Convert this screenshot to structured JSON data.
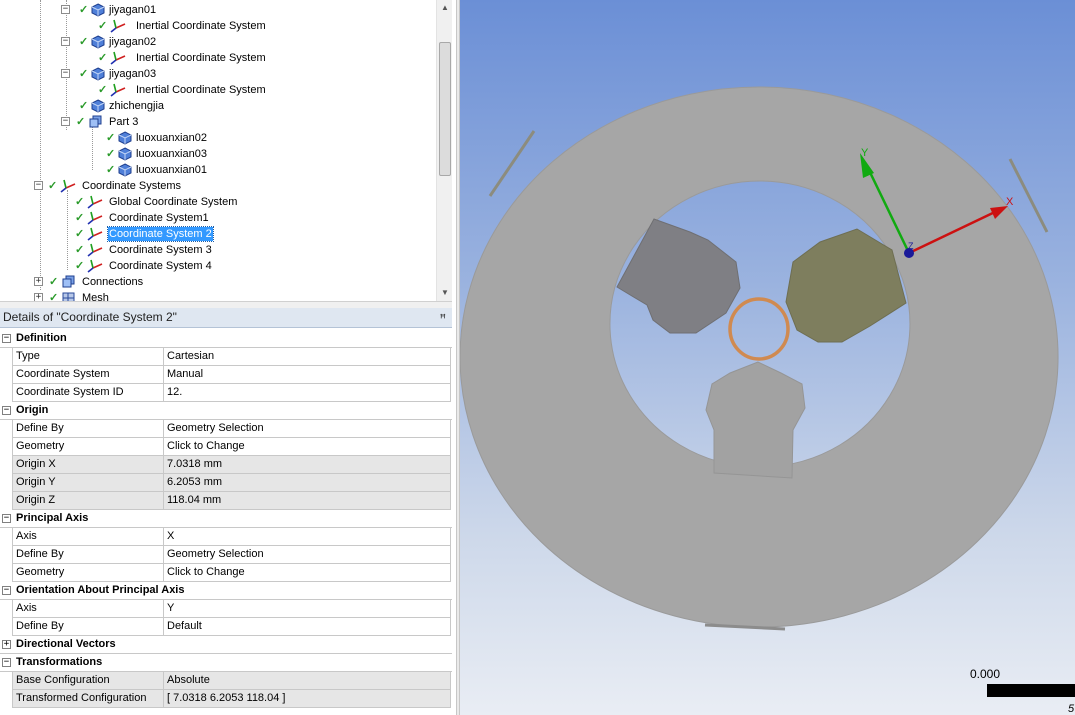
{
  "tree": {
    "items": [
      {
        "label": "jiyagan01",
        "icon": "body-icon",
        "expander": "−"
      },
      {
        "label": "Inertial Coordinate System",
        "icon": "coordinate-system-icon",
        "expander": ""
      },
      {
        "label": "jiyagan02",
        "icon": "body-icon",
        "expander": "−"
      },
      {
        "label": "Inertial Coordinate System",
        "icon": "coordinate-system-icon",
        "expander": ""
      },
      {
        "label": "jiyagan03",
        "icon": "body-icon",
        "expander": "−"
      },
      {
        "label": "Inertial Coordinate System",
        "icon": "coordinate-system-icon",
        "expander": ""
      },
      {
        "label": "zhichengjia",
        "icon": "body-icon",
        "expander": ""
      },
      {
        "label": "Part 3",
        "icon": "part-icon",
        "expander": "−"
      },
      {
        "label": "luoxuanxian02",
        "icon": "body-icon",
        "expander": ""
      },
      {
        "label": "luoxuanxian03",
        "icon": "body-icon",
        "expander": ""
      },
      {
        "label": "luoxuanxian01",
        "icon": "body-icon",
        "expander": ""
      },
      {
        "label": "Coordinate Systems",
        "icon": "coordinate-systems-folder-icon",
        "expander": "−"
      },
      {
        "label": "Global Coordinate System",
        "icon": "coordinate-system-icon",
        "expander": ""
      },
      {
        "label": "Coordinate System1",
        "icon": "coordinate-system-icon",
        "expander": ""
      },
      {
        "label": "Coordinate System 2",
        "icon": "coordinate-system-icon",
        "expander": "",
        "selected": true
      },
      {
        "label": "Coordinate System 3",
        "icon": "coordinate-system-icon",
        "expander": ""
      },
      {
        "label": "Coordinate System 4",
        "icon": "coordinate-system-icon",
        "expander": ""
      },
      {
        "label": "Connections",
        "icon": "connections-icon",
        "expander": "+"
      },
      {
        "label": "Mesh",
        "icon": "mesh-icon",
        "expander": "+"
      }
    ]
  },
  "details": {
    "title": "Details of \"Coordinate System 2\"",
    "pin": "ꟸ",
    "groups": [
      {
        "label": "Definition",
        "expander": "−",
        "props": [
          {
            "name": "Type",
            "value": "Cartesian"
          },
          {
            "name": "Coordinate System",
            "value": "Manual"
          },
          {
            "name": "Coordinate System ID",
            "value": "12."
          }
        ]
      },
      {
        "label": "Origin",
        "expander": "−",
        "props": [
          {
            "name": "Define By",
            "value": "Geometry Selection"
          },
          {
            "name": "Geometry",
            "value": "Click to Change"
          },
          {
            "name": "Origin X",
            "value": "7.0318 mm",
            "shaded": true
          },
          {
            "name": "Origin Y",
            "value": "6.2053 mm",
            "shaded": true
          },
          {
            "name": "Origin Z",
            "value": "118.04 mm",
            "shaded": true
          }
        ]
      },
      {
        "label": "Principal Axis",
        "expander": "−",
        "props": [
          {
            "name": "Axis",
            "value": "X"
          },
          {
            "name": "Define By",
            "value": "Geometry Selection"
          },
          {
            "name": "Geometry",
            "value": "Click to Change"
          }
        ]
      },
      {
        "label": "Orientation About Principal Axis",
        "expander": "−",
        "props": [
          {
            "name": "Axis",
            "value": "Y"
          },
          {
            "name": "Define By",
            "value": "Default"
          }
        ]
      },
      {
        "label": "Directional Vectors",
        "expander": "+",
        "props": []
      },
      {
        "label": "Transformations",
        "expander": "−",
        "props": [
          {
            "name": "Base Configuration",
            "value": "Absolute",
            "shaded": true
          },
          {
            "name": "Transformed Configuration",
            "value": "[  7.0318  6.2053  118.04  ]",
            "shaded": true
          }
        ]
      }
    ]
  },
  "viewport": {
    "triad": {
      "x_label": "X",
      "y_label": "Y",
      "z_label": "Z"
    },
    "scale_value": "0.000",
    "scale_tick": "5",
    "colors": {
      "x_axis": "#cc1111",
      "y_axis": "#11aa11",
      "z_axis": "#1a1a99",
      "disc": "#a6a6a6",
      "ring": "#d08a50",
      "block_left": "#7f7f84",
      "block_right": "#7e7e5e",
      "block_bottom": "#a2a2a2"
    }
  }
}
